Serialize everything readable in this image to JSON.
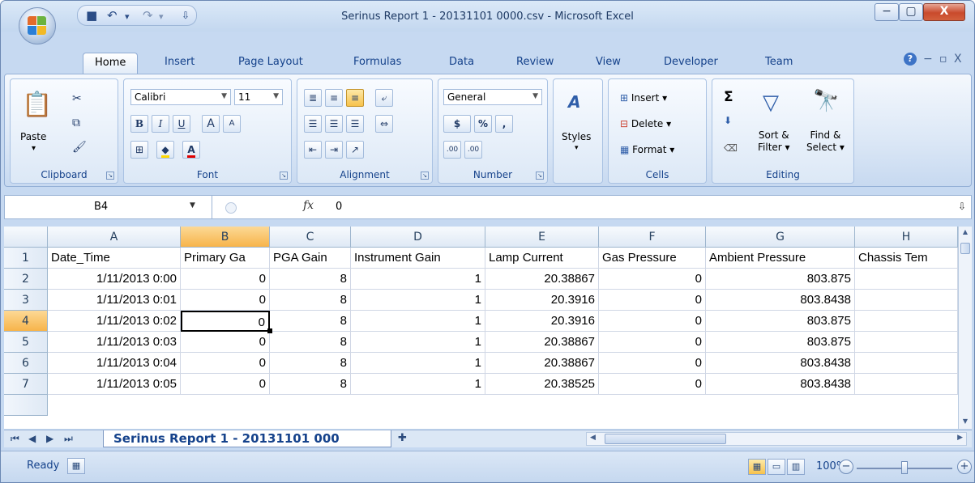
{
  "window": {
    "title": "Serinus Report 1 - 20131101 0000.csv - Microsoft Excel",
    "controls": {
      "minimize": "▭",
      "maximize": "▢",
      "close": "X"
    }
  },
  "qat": {
    "save": "💾",
    "undo": "↶",
    "redo": "↷",
    "customize": "⚲"
  },
  "tabs": [
    "Home",
    "Insert",
    "Page Layout",
    "Formulas",
    "Data",
    "Review",
    "View",
    "Developer",
    "Team"
  ],
  "help_controls": {
    "help": "?",
    "min": "−",
    "restore": "▫",
    "close": "X"
  },
  "ribbon": {
    "clipboard": {
      "label": "Clipboard",
      "paste": "Paste",
      "paste_arrow": "▾"
    },
    "font": {
      "label": "Font",
      "family": "Calibri",
      "size": "11",
      "bold": "B",
      "italic": "I",
      "underline": "U",
      "grow": "A",
      "shrink": "A",
      "font_color": "A"
    },
    "alignment": {
      "label": "Alignment"
    },
    "number": {
      "label": "Number",
      "format": "General",
      "currency": "$",
      "percent": "%",
      "comma": ",",
      "inc_dec": ".00",
      "dec_dec": ".00"
    },
    "styles": {
      "label": "Styles"
    },
    "cells": {
      "label": "Cells",
      "insert": "Insert",
      "delete": "Delete",
      "format": "Format"
    },
    "editing": {
      "label": "Editing",
      "sigma": "Σ",
      "sort_filter_1": "Sort &",
      "sort_filter_2": "Filter",
      "find_select_1": "Find &",
      "find_select_2": "Select"
    }
  },
  "formula_bar": {
    "name_box": "B4",
    "fx": "fx",
    "value": "0"
  },
  "grid": {
    "columns": [
      "A",
      "B",
      "C",
      "D",
      "E",
      "F",
      "G",
      "H"
    ],
    "rows": [
      [
        "Date_Time",
        "Primary Ga",
        "PGA Gain",
        "Instrument Gain",
        "Lamp Current",
        "Gas Pressure",
        "Ambient Pressure",
        "Chassis Tem"
      ],
      [
        "1/11/2013 0:00",
        "0",
        "8",
        "1",
        "20.38867",
        "0",
        "803.875",
        ""
      ],
      [
        "1/11/2013 0:01",
        "0",
        "8",
        "1",
        "20.3916",
        "0",
        "803.8438",
        ""
      ],
      [
        "1/11/2013 0:02",
        "0",
        "8",
        "1",
        "20.3916",
        "0",
        "803.875",
        ""
      ],
      [
        "1/11/2013 0:03",
        "0",
        "8",
        "1",
        "20.38867",
        "0",
        "803.875",
        ""
      ],
      [
        "1/11/2013 0:04",
        "0",
        "8",
        "1",
        "20.38867",
        "0",
        "803.8438",
        ""
      ],
      [
        "1/11/2013 0:05",
        "0",
        "8",
        "1",
        "20.38525",
        "0",
        "803.8438",
        ""
      ]
    ],
    "row_numbers": [
      "1",
      "2",
      "3",
      "4",
      "5",
      "6",
      "7"
    ],
    "selected_cell": "B4"
  },
  "sheet": {
    "tab_label": "Serinus Report 1 - 20131101 000"
  },
  "status": {
    "ready": "Ready",
    "zoom": "100%",
    "zoom_minus": "−",
    "zoom_plus": "+"
  }
}
